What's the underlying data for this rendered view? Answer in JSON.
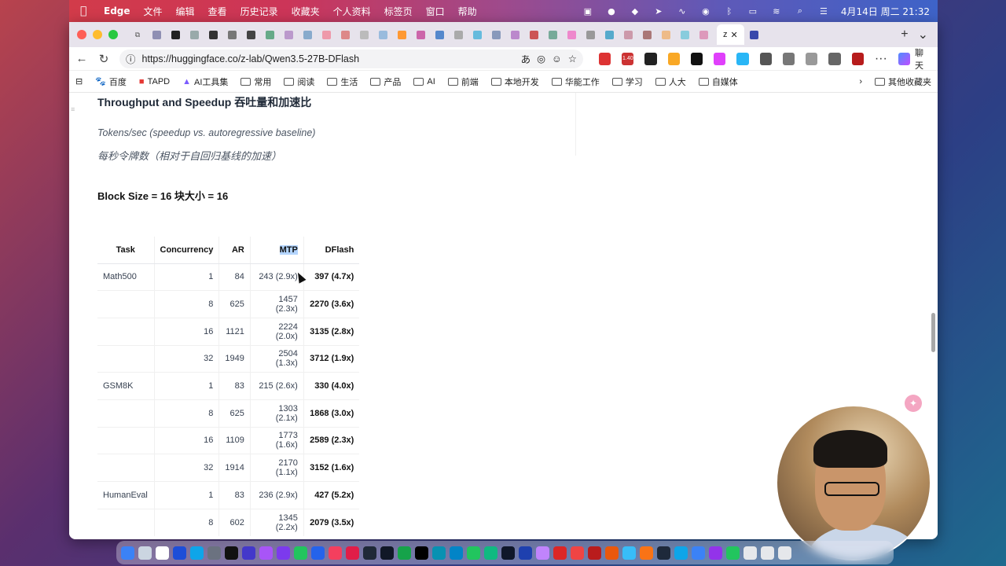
{
  "menubar": {
    "app_name": "Edge",
    "items": [
      "文件",
      "编辑",
      "查看",
      "历史记录",
      "收藏夹",
      "个人资料",
      "标签页",
      "窗口",
      "帮助"
    ],
    "clock": "4月14日 周二  21:32"
  },
  "tabs": {
    "active_label": "z"
  },
  "address": {
    "url": "https://huggingface.co/z-lab/Qwen3.5-27B-DFlash",
    "ext_badge": "1.40",
    "chat_label": "聊天"
  },
  "bookmarks": {
    "items": [
      "百度",
      "TAPD",
      "AI工具集",
      "常用",
      "阅读",
      "生活",
      "产品",
      "AI",
      "前端",
      "本地开发",
      "华能工作",
      "学习",
      "人大",
      "自媒体"
    ],
    "other": "其他收藏夹"
  },
  "article": {
    "heading": "Throughput and Speedup  吞吐量和加速比",
    "subtitle_en": "Tokens/sec (speedup vs. autoregressive baseline)",
    "subtitle_zh": "每秒令牌数（相对于自回归基线的加速）",
    "block_heading": "Block Size = 16  块大小 = 16"
  },
  "table": {
    "headers": [
      "Task",
      "Concurrency",
      "AR",
      "MTP",
      "DFlash"
    ],
    "rows": [
      {
        "task": "Math500",
        "concurrency": "1",
        "ar": "84",
        "mtp": "243 (2.9x)",
        "dflash": "397 (4.7x)"
      },
      {
        "task": "",
        "concurrency": "8",
        "ar": "625",
        "mtp": "1457 (2.3x)",
        "dflash": "2270 (3.6x)"
      },
      {
        "task": "",
        "concurrency": "16",
        "ar": "1121",
        "mtp": "2224 (2.0x)",
        "dflash": "3135 (2.8x)"
      },
      {
        "task": "",
        "concurrency": "32",
        "ar": "1949",
        "mtp": "2504 (1.3x)",
        "dflash": "3712 (1.9x)"
      },
      {
        "task": "GSM8K",
        "concurrency": "1",
        "ar": "83",
        "mtp": "215 (2.6x)",
        "dflash": "330 (4.0x)"
      },
      {
        "task": "",
        "concurrency": "8",
        "ar": "625",
        "mtp": "1303 (2.1x)",
        "dflash": "1868 (3.0x)"
      },
      {
        "task": "",
        "concurrency": "16",
        "ar": "1109",
        "mtp": "1773 (1.6x)",
        "dflash": "2589 (2.3x)"
      },
      {
        "task": "",
        "concurrency": "32",
        "ar": "1914",
        "mtp": "2170 (1.1x)",
        "dflash": "3152 (1.6x)"
      },
      {
        "task": "HumanEval",
        "concurrency": "1",
        "ar": "83",
        "mtp": "236 (2.9x)",
        "dflash": "427 (5.2x)"
      },
      {
        "task": "",
        "concurrency": "8",
        "ar": "602",
        "mtp": "1345 (2.2x)",
        "dflash": "2079 (3.5x)"
      }
    ]
  },
  "colors": {
    "mtp_highlight": "#b4d5fe",
    "accent": "#1f2937"
  }
}
